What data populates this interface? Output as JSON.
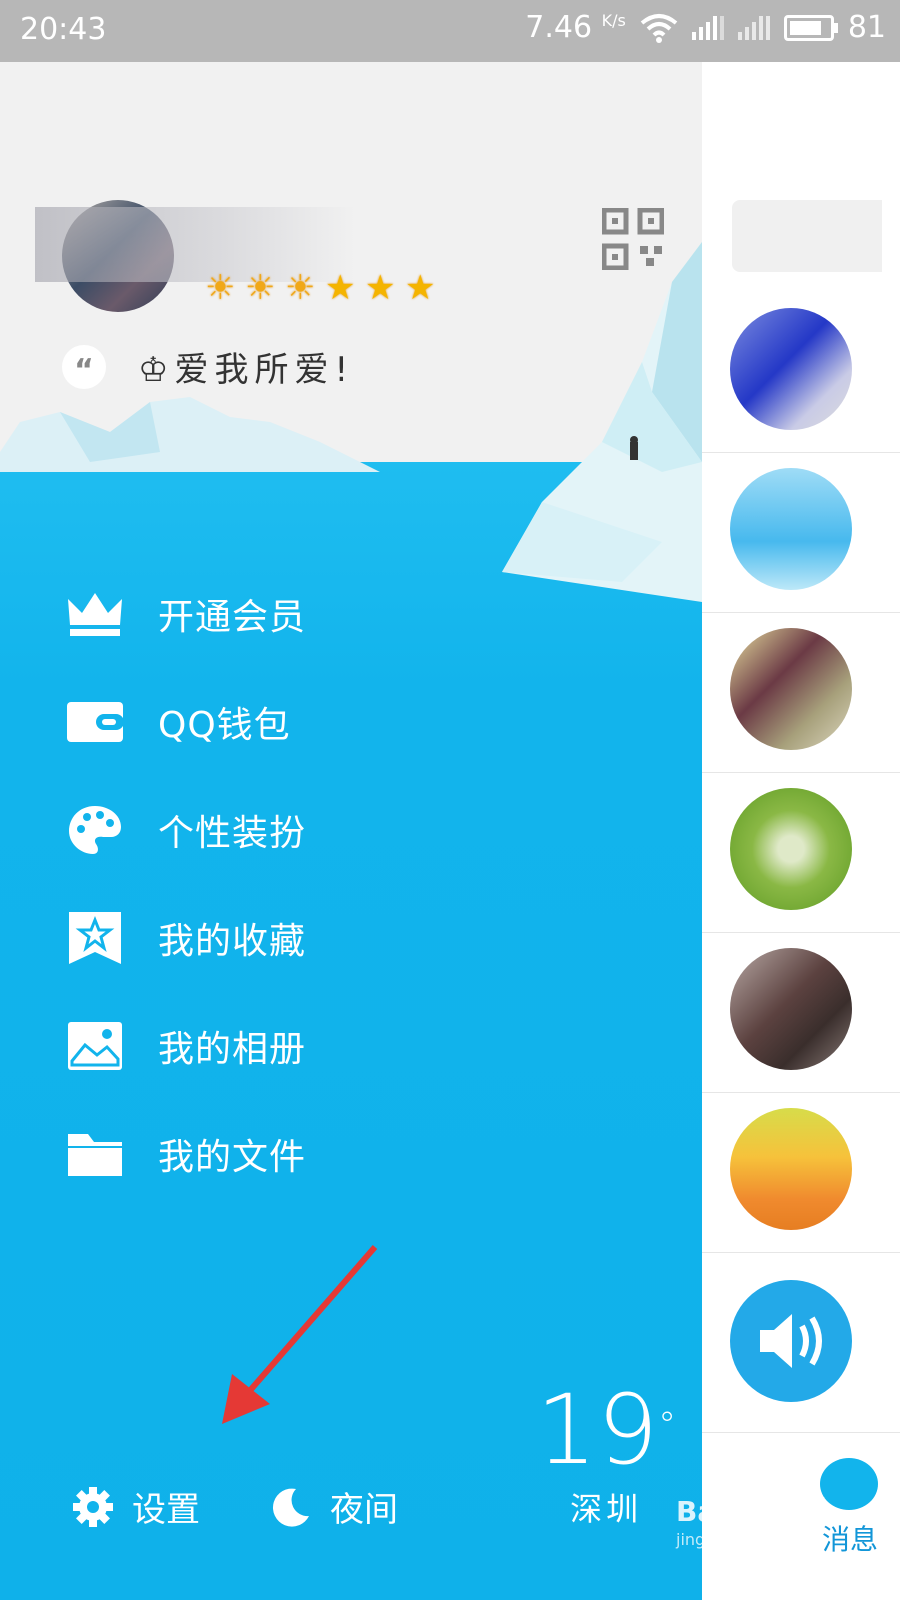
{
  "status_bar": {
    "time": "20:43",
    "speed": "7.46",
    "speed_unit": "K/s",
    "battery": "81"
  },
  "profile": {
    "signature": "爱我所爱!",
    "quote_mark": "“",
    "level_icons": [
      "sun-icon",
      "sun-icon",
      "sun-icon",
      "star-icon",
      "star-icon",
      "star-icon"
    ]
  },
  "menu": [
    {
      "icon": "crown-icon",
      "label": "开通会员"
    },
    {
      "icon": "wallet-icon",
      "label": "QQ钱包"
    },
    {
      "icon": "palette-icon",
      "label": "个性装扮"
    },
    {
      "icon": "bookmark-star-icon",
      "label": "我的收藏"
    },
    {
      "icon": "picture-icon",
      "label": "我的相册"
    },
    {
      "icon": "folder-icon",
      "label": "我的文件"
    }
  ],
  "bottom": {
    "settings_label": "设置",
    "night_label": "夜间"
  },
  "weather": {
    "temperature": "19",
    "degree_symbol": "°",
    "city": "深圳"
  },
  "right_pane": {
    "tab_label": "消息"
  },
  "watermark": {
    "brand": "Baidu 经验",
    "url": "jingyan.baidu.com"
  },
  "colors": {
    "drawer_blue": "#12b4ec",
    "annotation_arrow": "#e53935",
    "status_bar": "#b7b7b7"
  }
}
